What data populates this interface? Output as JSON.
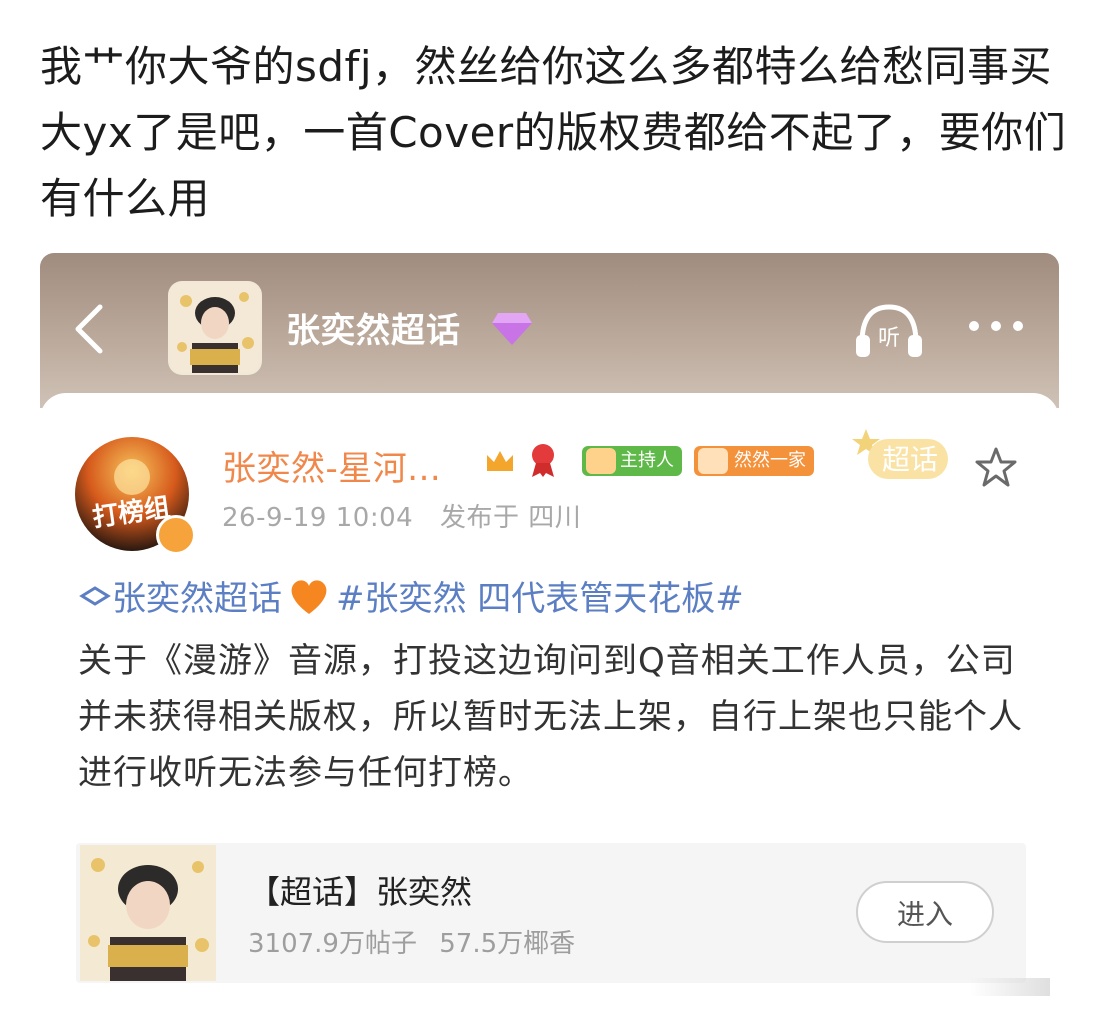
{
  "caption": "我艹你大爷的sdfj，然丝给你这么多都特么给愁同事买大yx了是吧，一首Cover的版权费都给不起了，要你们有什么用",
  "header": {
    "title": "张奕然超话",
    "listen_label": "听"
  },
  "post": {
    "username": "张奕然-星河...",
    "badge_host": "主持人",
    "badge_fan": "然然一家",
    "super_tag": "超话",
    "timestamp": "26-9-19 10:04",
    "location": "发布于 四川",
    "topic_link": "张奕然超话",
    "hashtag": "#张奕然 四代表管天花板#",
    "text": "关于《漫游》音源，打投这边询问到Q音相关工作人员，公司并未获得相关版权，所以暂时无法上架，自行上架也只能个人进行收听无法参与任何打榜。",
    "avatar_text": "打榜组"
  },
  "topic_card": {
    "title": "【超话】张奕然",
    "posts": "3107.9万帖子",
    "fans": "57.5万椰香",
    "enter_label": "进入"
  },
  "colors": {
    "header_bg": "#b3a192",
    "username": "#f0884b",
    "link": "#5c7fc4",
    "badge_host": "#5fb949",
    "badge_fan": "#f4923c"
  }
}
